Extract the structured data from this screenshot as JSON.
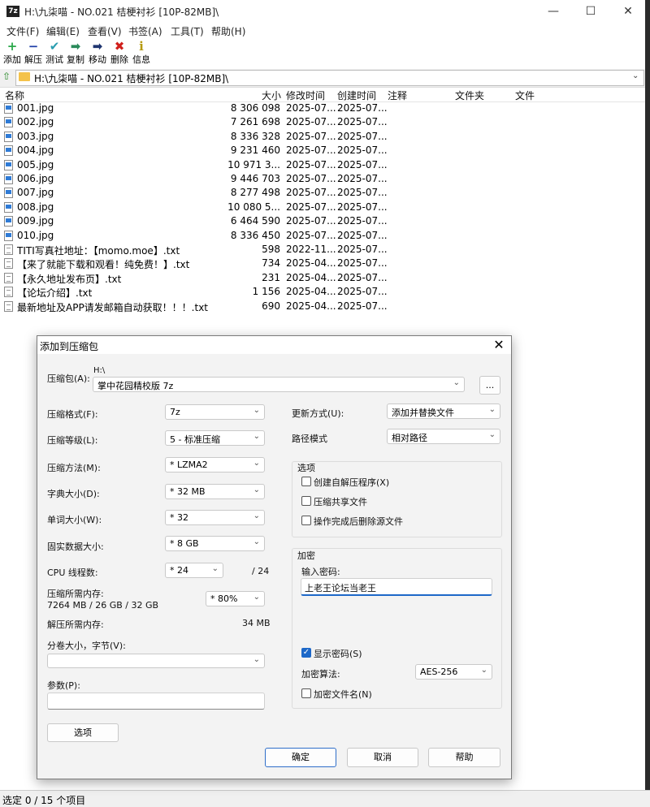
{
  "window": {
    "title": "H:\\九柒喵 - NO.021 桔梗衬衫 [10P-82MB]\\",
    "icon_text": "7z"
  },
  "menu": [
    "文件(F)",
    "编辑(E)",
    "查看(V)",
    "书签(A)",
    "工具(T)",
    "帮助(H)"
  ],
  "toolbar": [
    {
      "label": "添加",
      "icon": "plus-icon",
      "glyph": "+",
      "color": "#2aa84a"
    },
    {
      "label": "解压",
      "icon": "minus-icon",
      "glyph": "−",
      "color": "#1f3fa8"
    },
    {
      "label": "测试",
      "icon": "check-icon",
      "glyph": "✔",
      "color": "#2a9db0"
    },
    {
      "label": "复制",
      "icon": "copy-arrow-icon",
      "glyph": "➡",
      "color": "#2a8a5a"
    },
    {
      "label": "移动",
      "icon": "move-arrow-icon",
      "glyph": "➡",
      "color": "#1f3570"
    },
    {
      "label": "删除",
      "icon": "delete-icon",
      "glyph": "✖",
      "color": "#d0201c"
    },
    {
      "label": "信息",
      "icon": "info-icon",
      "glyph": "i",
      "color": "#b59a10"
    }
  ],
  "address": {
    "path": "H:\\九柒喵 - NO.021 桔梗衬衫 [10P-82MB]\\"
  },
  "columns": {
    "name": "名称",
    "size": "大小",
    "modified": "修改时间",
    "created": "创建时间",
    "comment": "注释",
    "folders": "文件夹",
    "files": "文件"
  },
  "files": [
    {
      "name": "001.jpg",
      "size": "8 306 098",
      "modified": "2025-07...",
      "created": "2025-07...",
      "type": "img"
    },
    {
      "name": "002.jpg",
      "size": "7 261 698",
      "modified": "2025-07...",
      "created": "2025-07...",
      "type": "img"
    },
    {
      "name": "003.jpg",
      "size": "8 336 328",
      "modified": "2025-07...",
      "created": "2025-07...",
      "type": "img"
    },
    {
      "name": "004.jpg",
      "size": "9 231 460",
      "modified": "2025-07...",
      "created": "2025-07...",
      "type": "img"
    },
    {
      "name": "005.jpg",
      "size": "10 971 3...",
      "modified": "2025-07...",
      "created": "2025-07...",
      "type": "img"
    },
    {
      "name": "006.jpg",
      "size": "9 446 703",
      "modified": "2025-07...",
      "created": "2025-07...",
      "type": "img"
    },
    {
      "name": "007.jpg",
      "size": "8 277 498",
      "modified": "2025-07...",
      "created": "2025-07...",
      "type": "img"
    },
    {
      "name": "008.jpg",
      "size": "10 080 5...",
      "modified": "2025-07...",
      "created": "2025-07...",
      "type": "img"
    },
    {
      "name": "009.jpg",
      "size": "6 464 590",
      "modified": "2025-07...",
      "created": "2025-07...",
      "type": "img"
    },
    {
      "name": "010.jpg",
      "size": "8 336 450",
      "modified": "2025-07...",
      "created": "2025-07...",
      "type": "img"
    },
    {
      "name": "TITI写真社地址：【momo.moe】.txt",
      "size": "598",
      "modified": "2022-11...",
      "created": "2025-07...",
      "type": "txt"
    },
    {
      "name": "【来了就能下载和观看！纯免费！】.txt",
      "size": "734",
      "modified": "2025-04...",
      "created": "2025-07...",
      "type": "txt"
    },
    {
      "name": "【永久地址发布页】.txt",
      "size": "231",
      "modified": "2025-04...",
      "created": "2025-07...",
      "type": "txt"
    },
    {
      "name": "【论坛介绍】.txt",
      "size": "1 156",
      "modified": "2025-04...",
      "created": "2025-07...",
      "type": "txt"
    },
    {
      "name": "最新地址及APP请发邮箱自动获取！！！.txt",
      "size": "690",
      "modified": "2025-04...",
      "created": "2025-07...",
      "type": "txt"
    }
  ],
  "status": {
    "text": "选定 0 / 15 个项目"
  },
  "dialog": {
    "title": "添加到压缩包",
    "archive_label": "压缩包(A):",
    "archive_dir": "H:\\",
    "archive_name": "掌中花园精校版 7z",
    "browse_label": "...",
    "format_label": "压缩格式(F):",
    "format_value": "7z",
    "level_label": "压缩等级(L):",
    "level_value": "5 - 标准压缩",
    "method_label": "压缩方法(M):",
    "method_value": "* LZMA2",
    "dict_label": "字典大小(D):",
    "dict_value": "* 32 MB",
    "word_label": "单词大小(W):",
    "word_value": "* 32",
    "solid_label": "固实数据大小:",
    "solid_value": "* 8 GB",
    "cpu_label": "CPU 线程数:",
    "cpu_value": "* 24",
    "cpu_total": "/ 24",
    "mem_label": "压缩所需内存:",
    "mem_detail": "7264 MB / 26 GB / 32 GB",
    "mem_value": "* 80%",
    "decomp_label": "解压所需内存:",
    "decomp_value": "34 MB",
    "split_label": "分卷大小，字节(V):",
    "split_value": "",
    "params_label": "参数(P):",
    "params_value": "",
    "options_button": "选项",
    "update_label": "更新方式(U):",
    "update_value": "添加并替换文件",
    "path_label": "路径模式",
    "path_value": "相对路径",
    "options_group": "选项",
    "opt_sfx": "创建自解压程序(X)",
    "opt_shared": "压缩共享文件",
    "opt_delete": "操作完成后删除源文件",
    "enc_group": "加密",
    "pwd_label": "输入密码:",
    "pwd_value": "上老王论坛当老王",
    "show_pwd": "显示密码(S)",
    "enc_method_label": "加密算法:",
    "enc_method_value": "AES-256",
    "enc_names": "加密文件名(N)",
    "ok": "确定",
    "cancel": "取消",
    "help": "帮助"
  }
}
